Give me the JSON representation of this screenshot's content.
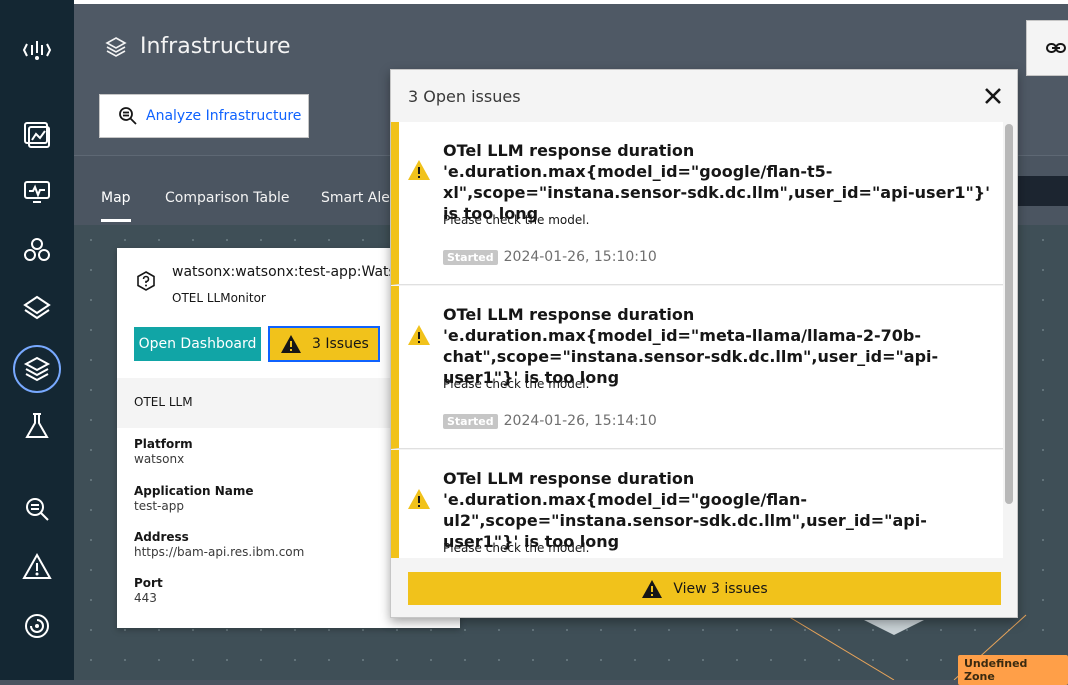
{
  "header": {
    "title": "Infrastructure",
    "analyze_label": "Analyze Infrastructure"
  },
  "tabs": [
    {
      "label": "Map"
    },
    {
      "label": "Comparison Table"
    },
    {
      "label": "Smart Ale"
    }
  ],
  "entity_card": {
    "name": "watsonx:watsonx:test-app:Watso",
    "type": "OTEL LLMonitor",
    "open_dashboard_label": "Open Dashboard",
    "issues_button_label": "3 Issues",
    "section_label": "OTEL LLM",
    "properties": [
      {
        "label": "Platform",
        "value": "watsonx"
      },
      {
        "label": "Application Name",
        "value": "test-app"
      },
      {
        "label": "Address",
        "value": "https://bam-api.res.ibm.com"
      },
      {
        "label": "Port",
        "value": "443"
      }
    ]
  },
  "issues_popover": {
    "title": "3 Open issues",
    "view_button_label": "View 3 issues",
    "issues": [
      {
        "title": "OTel LLM response duration 'e.duration.max{model_id=\"google/flan-t5-xl\",scope=\"instana.sensor-sdk.dc.llm\",user_id=\"api-user1\"}' is too long",
        "message": "Please check the model.",
        "started_label": "Started",
        "started_time": "2024-01-26, 15:10:10"
      },
      {
        "title": "OTel LLM response duration 'e.duration.max{model_id=\"meta-llama/llama-2-70b-chat\",scope=\"instana.sensor-sdk.dc.llm\",user_id=\"api-user1\"}' is too long",
        "message": "Please check the model.",
        "started_label": "Started",
        "started_time": "2024-01-26, 15:14:10"
      },
      {
        "title": "OTel LLM response duration 'e.duration.max{model_id=\"google/flan-ul2\",scope=\"instana.sensor-sdk.dc.llm\",user_id=\"api-user1\"}' is too long",
        "message": "Please check the model."
      }
    ]
  },
  "map": {
    "zone_label": "Undefined Zone"
  },
  "colors": {
    "accent_blue": "#0f62fe",
    "warning_yellow": "#f1c21b",
    "teal": "#11a5a6",
    "nav_bg": "#142733"
  }
}
